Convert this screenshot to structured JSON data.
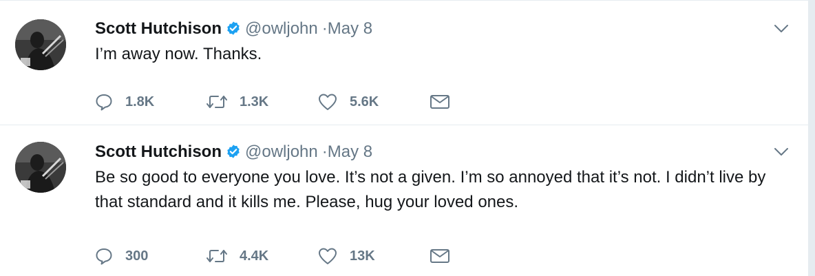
{
  "colors": {
    "verified": "#1da1f2",
    "secondary_text": "#657786",
    "primary_text": "#14171a",
    "divider": "#e6ecf0"
  },
  "tweets": [
    {
      "author": "Scott Hutchison",
      "handle": "@owljohn",
      "separator": "·",
      "date": "May 8",
      "text": "I’m away now. Thanks.",
      "replies": "1.8K",
      "retweets": "1.3K",
      "likes": "5.6K"
    },
    {
      "author": "Scott Hutchison",
      "handle": "@owljohn",
      "separator": "·",
      "date": "May 8",
      "text": "Be so good to everyone you love. It’s not a given. I’m so annoyed that it’s not. I didn’t live by that standard and it kills me. Please, hug your loved ones.",
      "replies": "300",
      "retweets": "4.4K",
      "likes": "13K"
    }
  ],
  "icons": {
    "verified": "verified-badge-icon",
    "caret": "chevron-down-icon",
    "reply": "reply-icon",
    "retweet": "retweet-icon",
    "like": "heart-icon",
    "dm": "envelope-icon"
  }
}
